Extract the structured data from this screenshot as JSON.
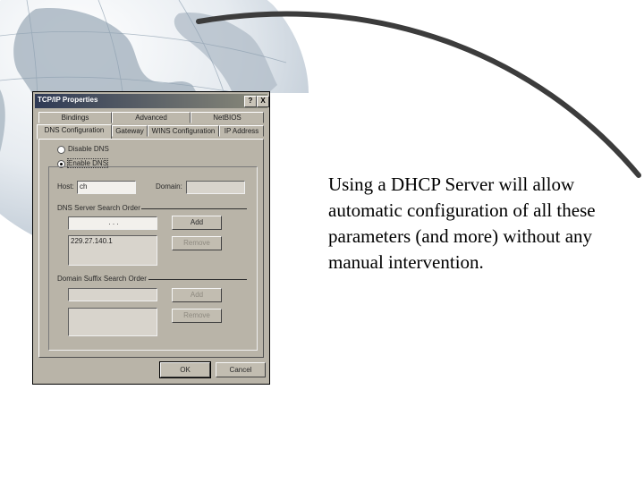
{
  "dialog": {
    "title": "TCP/IP Properties",
    "help_button": "?",
    "close_button": "X",
    "tabs_back_row": [
      "Bindings",
      "Advanced",
      "NetBIOS"
    ],
    "tabs_front_row": [
      "DNS Configuration",
      "Gateway",
      "WINS Configuration",
      "IP Address"
    ],
    "dns": {
      "disable_label": "Disable DNS",
      "enable_label": "Enable DNS",
      "host_label": "Host:",
      "host_value": "ch",
      "domain_label": "Domain:",
      "domain_value": "",
      "search_order_label": "DNS Server Search Order",
      "ip_entry_dots": ".   .   .",
      "add_button": "Add",
      "remove_button": "Remove",
      "server_list": [
        "229.27.140.1"
      ],
      "suffix_label": "Domain Suffix Search Order",
      "suffix_add_button": "Add",
      "suffix_remove_button": "Remove"
    },
    "ok_button": "OK",
    "cancel_button": "Cancel"
  },
  "caption": {
    "text": "Using a DHCP Server will allow automatic configuration of all these parameters (and more) without any manual intervention."
  }
}
